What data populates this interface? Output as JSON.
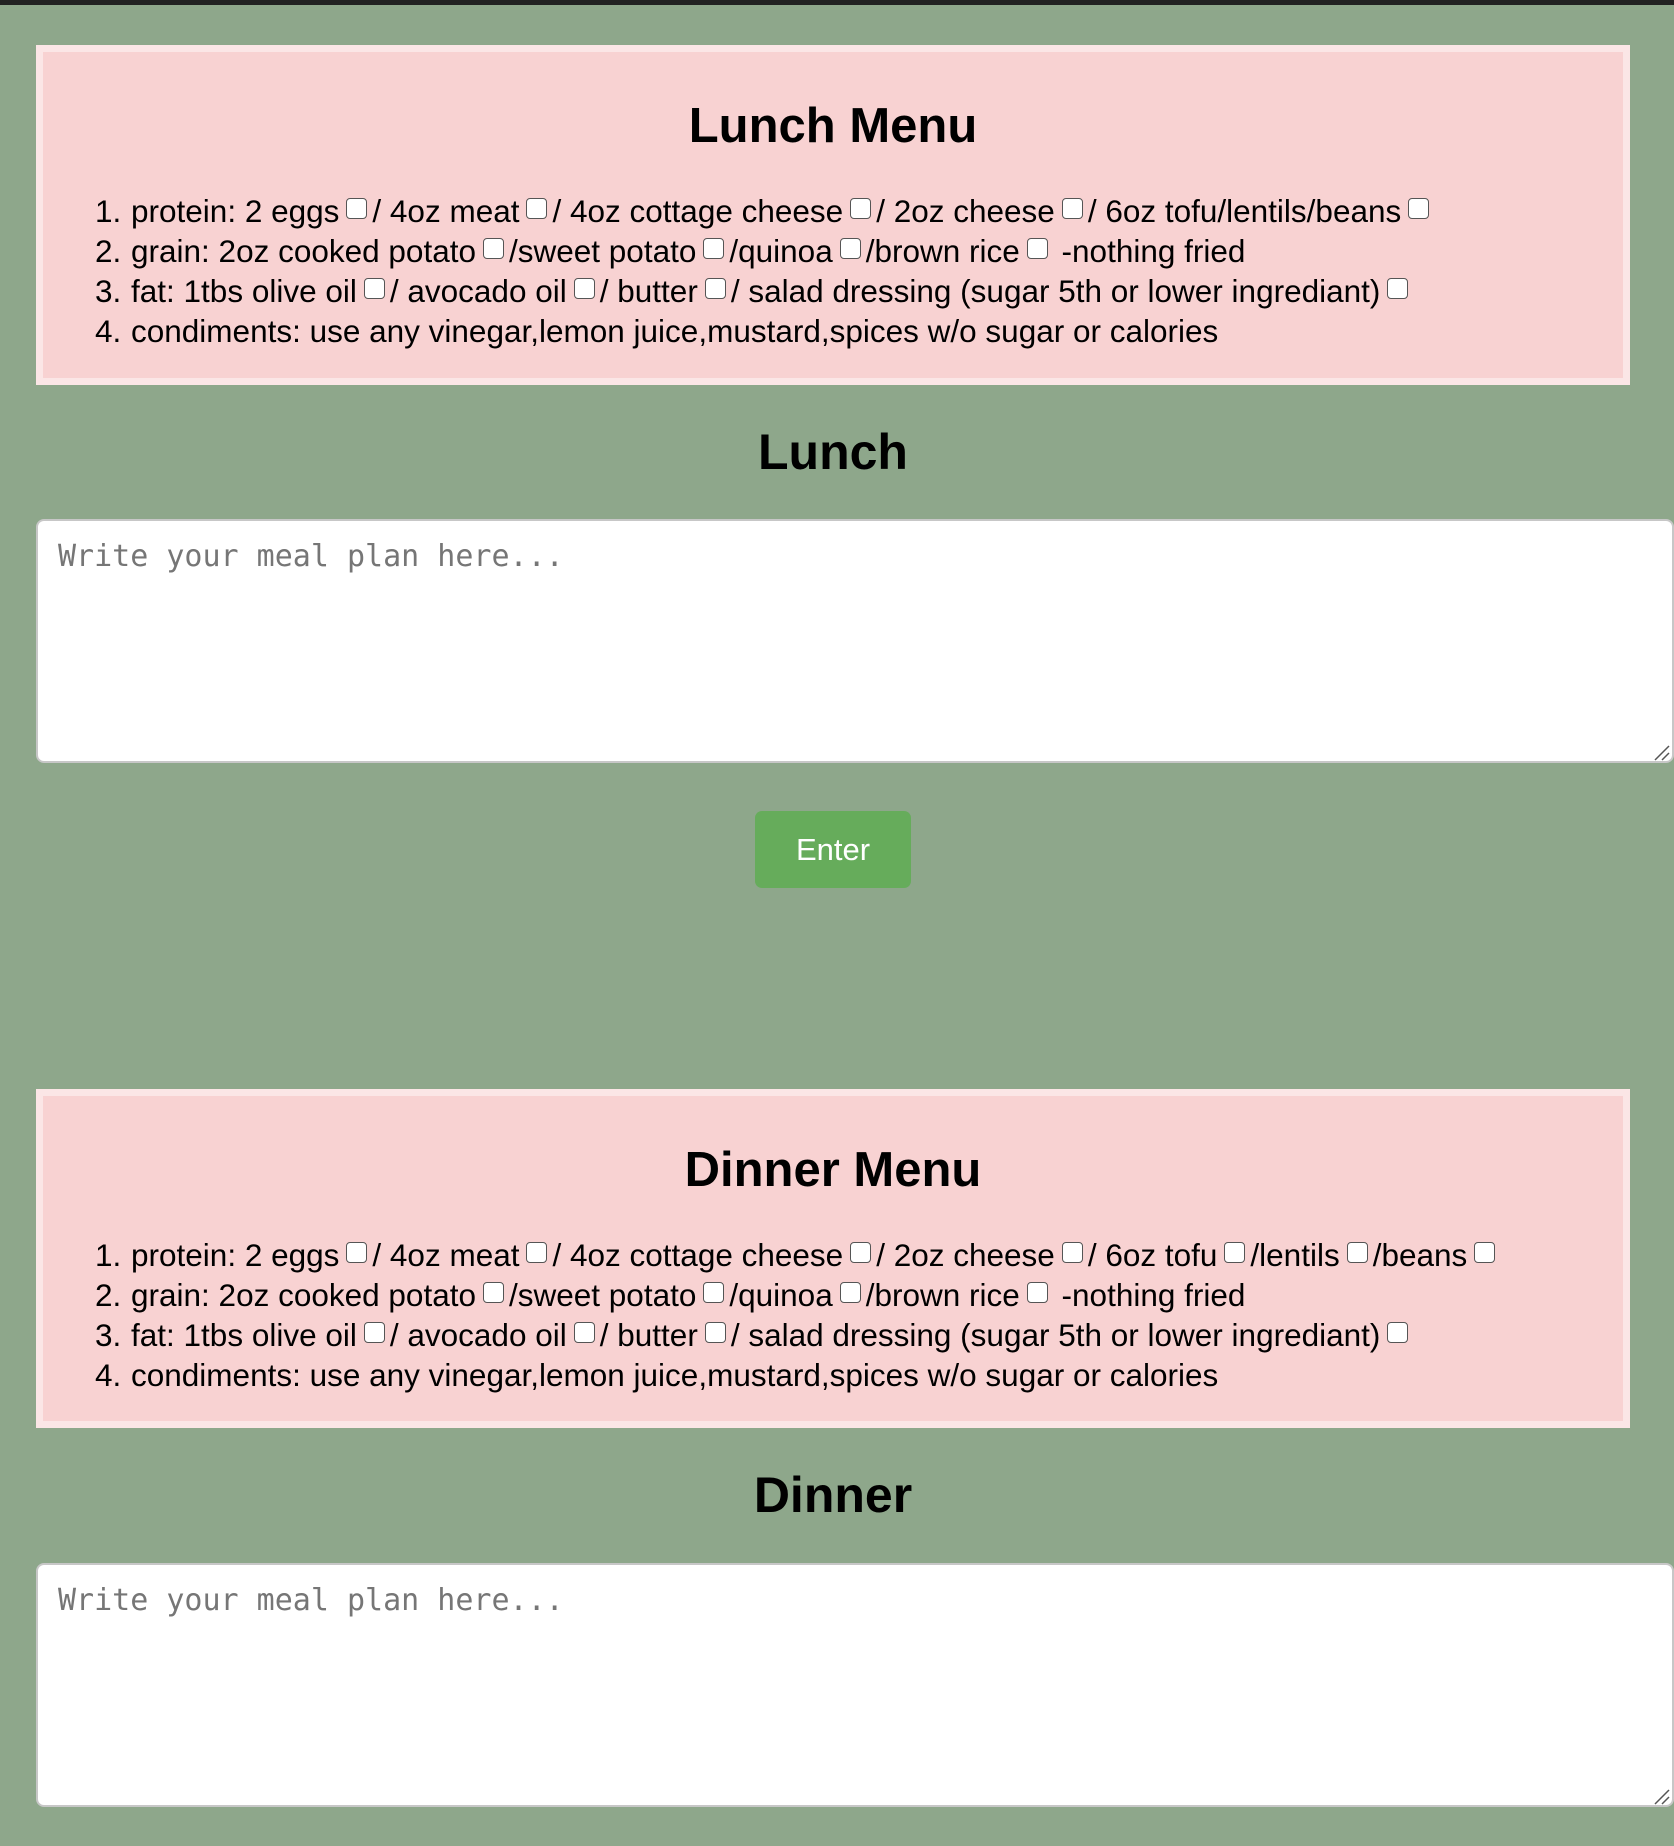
{
  "lunch": {
    "menu_title": "Lunch Menu",
    "items": [
      {
        "number": "1.",
        "parts": [
          "protein: 2 eggs",
          "/ 4oz meat",
          "/ 4oz cottage cheese",
          "/ 2oz cheese",
          "/ 6oz tofu/lentils/beans"
        ]
      },
      {
        "number": "2.",
        "parts": [
          "grain: 2oz cooked potato",
          "/sweet potato",
          "/quinoa",
          "/brown rice"
        ],
        "suffix": " -nothing fried"
      },
      {
        "number": "3.",
        "parts": [
          "fat: 1tbs olive oil",
          "/ avocado oil",
          "/ butter",
          "/ salad dressing (sugar 5th or lower ingrediant)"
        ]
      },
      {
        "number": "4.",
        "text": "condiments: use any vinegar,lemon juice,mustard,spices w/o sugar or calories"
      }
    ],
    "section_title": "Lunch",
    "textarea_placeholder": "Write your meal plan here...",
    "enter_label": "Enter"
  },
  "dinner": {
    "menu_title": "Dinner Menu",
    "items": [
      {
        "number": "1.",
        "parts": [
          "protein: 2 eggs",
          "/ 4oz meat",
          "/ 4oz cottage cheese",
          "/ 2oz cheese",
          "/ 6oz tofu",
          "/lentils",
          "/beans"
        ]
      },
      {
        "number": "2.",
        "parts": [
          "grain: 2oz cooked potato",
          "/sweet potato",
          "/quinoa",
          "/brown rice"
        ],
        "suffix": " -nothing fried"
      },
      {
        "number": "3.",
        "parts": [
          "fat: 1tbs olive oil",
          "/ avocado oil",
          "/ butter",
          "/ salad dressing (sugar 5th or lower ingrediant)"
        ]
      },
      {
        "number": "4.",
        "text": "condiments: use any vinegar,lemon juice,mustard,spices w/o sugar or calories"
      }
    ],
    "section_title": "Dinner",
    "textarea_placeholder": "Write your meal plan here..."
  }
}
